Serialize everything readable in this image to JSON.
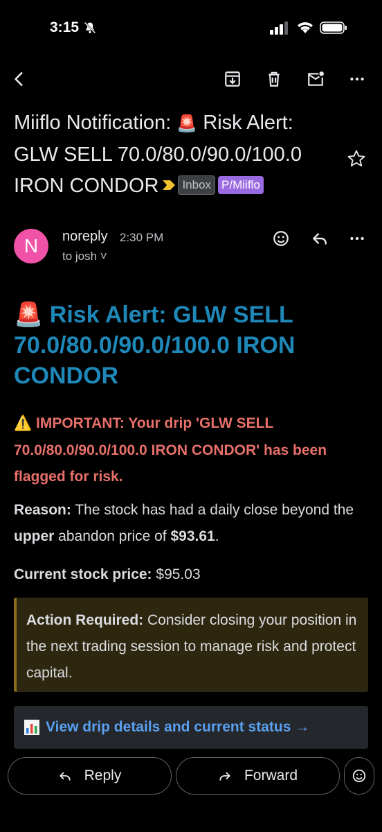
{
  "status_bar": {
    "time": "3:15"
  },
  "subject": {
    "prefix": "Miiflo Notification:",
    "siren": "🚨",
    "text": "Risk Alert: GLW SELL 70.0/80.0/90.0/100.0 IRON CONDOR",
    "chips": {
      "inbox": "Inbox",
      "label": "P/Miiflo"
    }
  },
  "sender": {
    "avatar_letter": "N",
    "name": "noreply",
    "time": "2:30 PM",
    "to": "to josh ˅"
  },
  "body": {
    "title_siren": "🚨",
    "title": "Risk Alert: GLW SELL 70.0/80.0/90.0/100.0 IRON CONDOR",
    "warning_icon": "⚠️",
    "important": "IMPORTANT: Your drip 'GLW SELL 70.0/80.0/90.0/100.0 IRON CONDOR' has been flagged for risk.",
    "reason": {
      "label": "Reason:",
      "text_1": " The stock has had a daily close beyond the ",
      "bold_word": "upper",
      "text_2": " abandon price of ",
      "price": "$93.61",
      "text_3": "."
    },
    "current": {
      "label": "Current stock price:",
      "value": " $95.03"
    },
    "action": {
      "label": "Action Required:",
      "text": " Consider closing your position in the next trading session to manage risk and protect capital."
    },
    "link": "View drip details and current status →"
  },
  "actions": {
    "reply": "Reply",
    "forward": "Forward"
  },
  "colors": {
    "title": "#1e88b8",
    "important": "#e8706a",
    "link": "#5aa0f0",
    "avatar": "#f052a8",
    "label_chip": "#9a6ae0"
  }
}
